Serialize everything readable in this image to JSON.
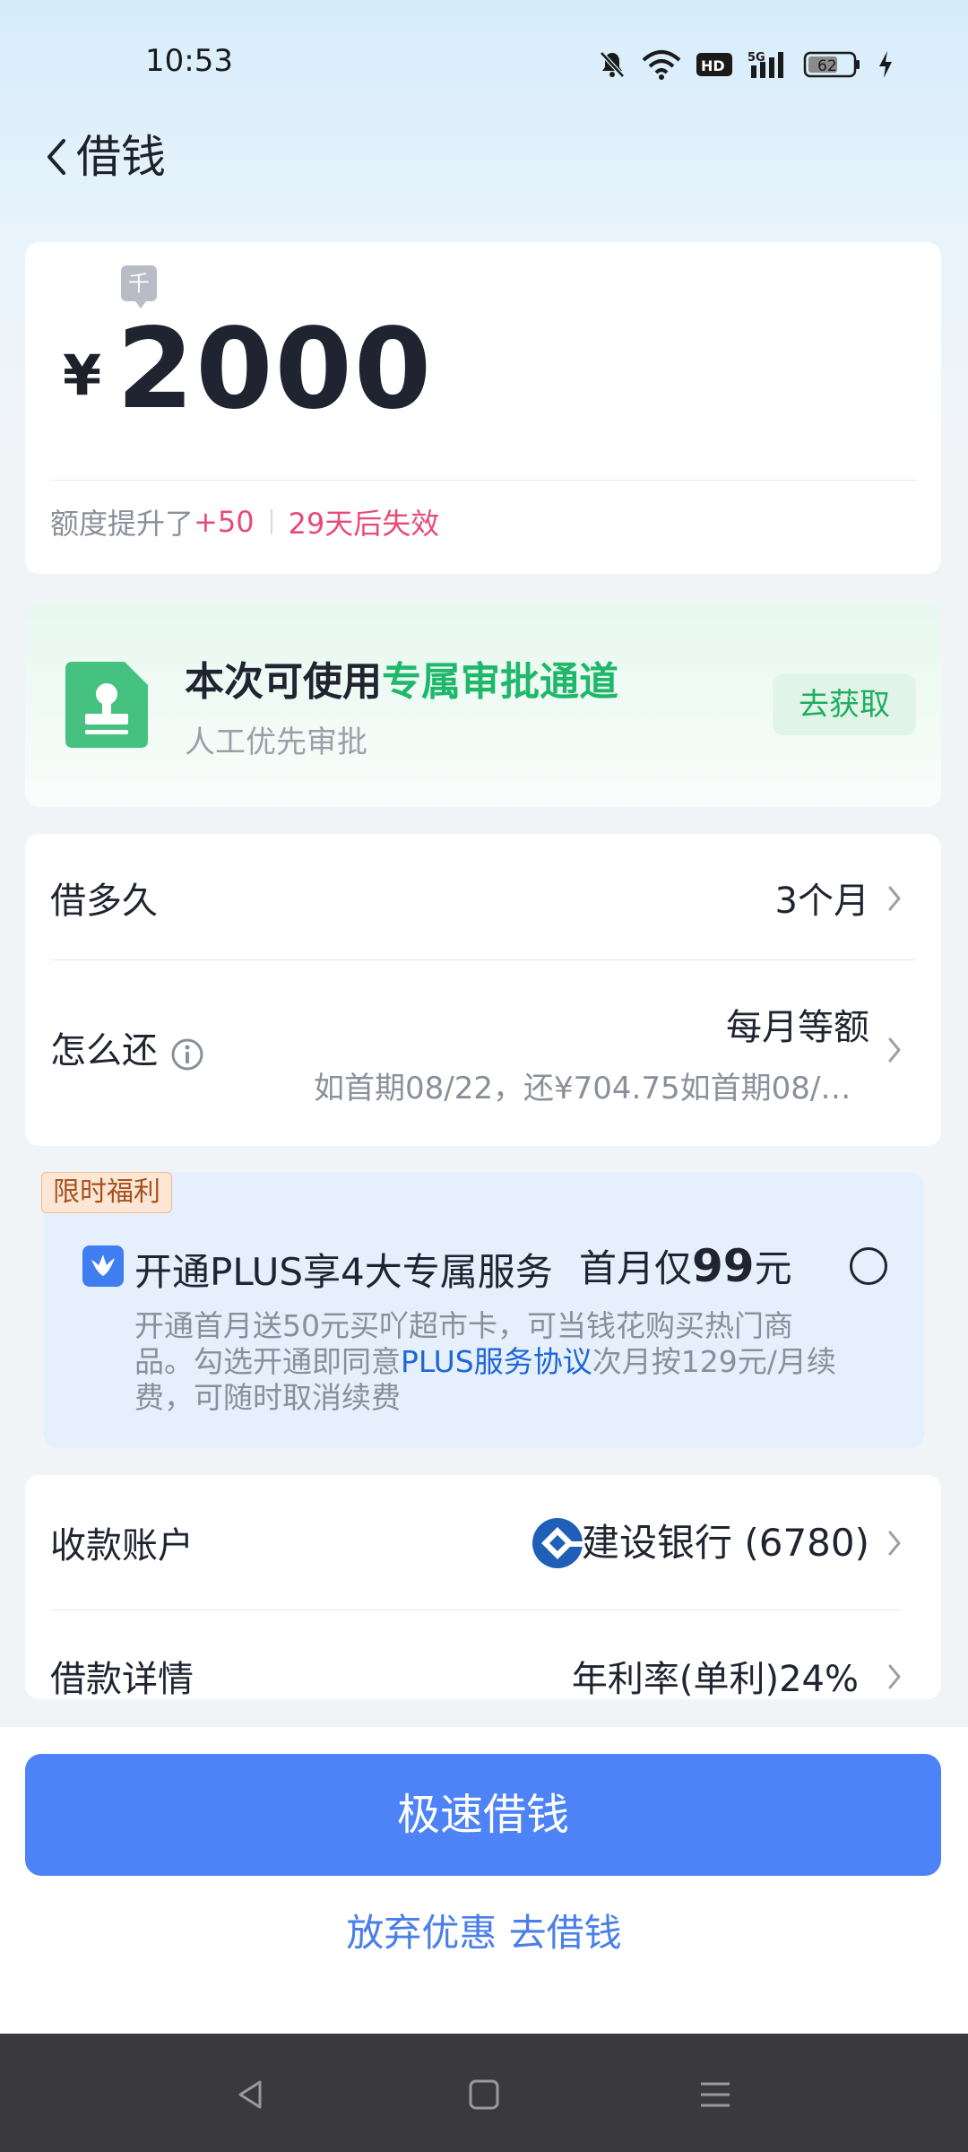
{
  "status_bar": {
    "time": "10:53",
    "battery": "62",
    "network_label": "5G",
    "hd_label": "HD"
  },
  "header": {
    "title": "借钱"
  },
  "amount": {
    "unit_tag": "千",
    "currency": "¥",
    "value": "2000",
    "quota_prefix": "额度提升了",
    "quota_increase": "+50",
    "quota_expire": "29天后失效"
  },
  "approval": {
    "title_prefix": "本次可使用",
    "title_highlight": "专属审批通道",
    "subtitle": "人工优先审批",
    "button_label": "去获取",
    "accent_color": "#1fb86b"
  },
  "loan": {
    "duration_label": "借多久",
    "duration_value": "3个月",
    "repay_label": "怎么还",
    "repay_method": "每月等额",
    "repay_detail": "如首期08/22，还¥704.75如首期08/22..."
  },
  "promo": {
    "tag": "限时福利",
    "title": "开通PLUS享4大专属服务",
    "price_prefix": "首月仅",
    "price_value": "99",
    "price_suffix": "元",
    "desc_part1": "开通首月送50元买吖超市卡，可当钱花购买热门商品。勾选开通即同意",
    "desc_link": "PLUS服务协议",
    "desc_part2": "次月按129元/月续费，可随时取消续费"
  },
  "account": {
    "receive_label": "收款账户",
    "bank_name": "建设银行 (6780)",
    "detail_label": "借款详情",
    "detail_value": "年利率(单利)24%"
  },
  "actions": {
    "primary_label": "极速借钱",
    "primary_color": "#4e83f8",
    "secondary_label": "放弃优惠 去借钱"
  },
  "nav": {
    "back_icon": "triangle-back-icon",
    "home_icon": "square-home-icon",
    "menu_icon": "lines-menu-icon"
  }
}
